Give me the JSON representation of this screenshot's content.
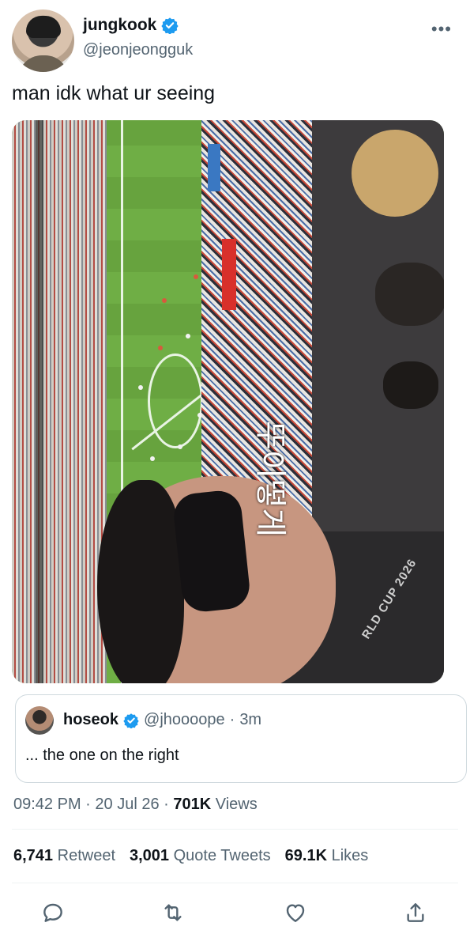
{
  "author": {
    "display_name": "jungkook",
    "handle": "@jeonjeongguk"
  },
  "more_glyph": "•••",
  "tweet": {
    "text": "man idk what ur seeing",
    "media_overlay_text": "뚜이떻게",
    "jacket_text": "RLD CUP 2026"
  },
  "quoted_tweet": {
    "display_name": "hoseok",
    "handle": "@jhoooope",
    "separator": "·",
    "time": "3m",
    "text": "... the one on the right"
  },
  "meta": {
    "time": "09:42 PM",
    "dot1": "·",
    "date": "20 Jul 26",
    "dot2": "·",
    "views_count": "701K",
    "views_label": "Views"
  },
  "stats": {
    "retweets_count": "6,741",
    "retweets_label": "Retweet",
    "quotes_count": "3,001",
    "quotes_label": "Quote Tweets",
    "likes_count": "69.1K",
    "likes_label": "Likes"
  },
  "actions": [
    "reply-icon",
    "retweet-icon",
    "like-icon",
    "share-icon"
  ],
  "colors": {
    "verified": "#1d9bf0",
    "text_primary": "#0f1419",
    "text_secondary": "#536471",
    "border": "#cfd9de"
  }
}
